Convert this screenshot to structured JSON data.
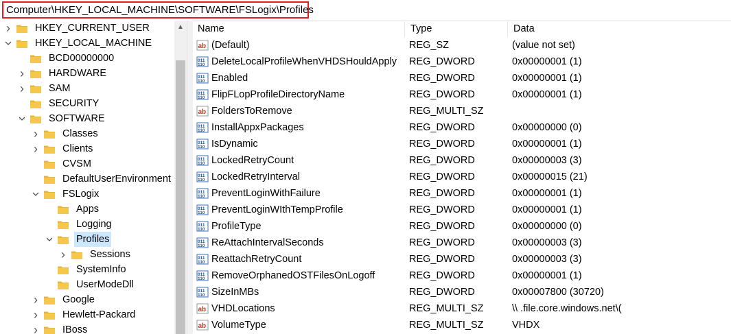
{
  "address": "Computer\\HKEY_LOCAL_MACHINE\\SOFTWARE\\FSLogix\\Profiles",
  "colors": {
    "highlight_border": "#e0201f",
    "selected_bg": "#cce8ff",
    "folder": "#e8b63c"
  },
  "tree": [
    {
      "label": "HKEY_CURRENT_USER",
      "expander": "collapsed",
      "level": 0
    },
    {
      "label": "HKEY_LOCAL_MACHINE",
      "expander": "expanded",
      "level": 0
    },
    {
      "label": "BCD00000000",
      "expander": "none",
      "level": 1
    },
    {
      "label": "HARDWARE",
      "expander": "collapsed",
      "level": 1
    },
    {
      "label": "SAM",
      "expander": "collapsed",
      "level": 1
    },
    {
      "label": "SECURITY",
      "expander": "none",
      "level": 1
    },
    {
      "label": "SOFTWARE",
      "expander": "expanded",
      "level": 1
    },
    {
      "label": "Classes",
      "expander": "collapsed",
      "level": 2
    },
    {
      "label": "Clients",
      "expander": "collapsed",
      "level": 2
    },
    {
      "label": "CVSM",
      "expander": "none",
      "level": 2
    },
    {
      "label": "DefaultUserEnvironment",
      "expander": "none",
      "level": 2
    },
    {
      "label": "FSLogix",
      "expander": "expanded",
      "level": 2
    },
    {
      "label": "Apps",
      "expander": "none",
      "level": 3
    },
    {
      "label": "Logging",
      "expander": "none",
      "level": 3
    },
    {
      "label": "Profiles",
      "expander": "expanded",
      "level": 3,
      "selected": true
    },
    {
      "label": "Sessions",
      "expander": "collapsed",
      "level": 4
    },
    {
      "label": "SystemInfo",
      "expander": "none",
      "level": 3
    },
    {
      "label": "UserModeDll",
      "expander": "none",
      "level": 3
    },
    {
      "label": "Google",
      "expander": "collapsed",
      "level": 2
    },
    {
      "label": "Hewlett-Packard",
      "expander": "collapsed",
      "level": 2
    },
    {
      "label": "IBoss",
      "expander": "collapsed",
      "level": 2
    }
  ],
  "columns": {
    "name": "Name",
    "type": "Type",
    "data": "Data"
  },
  "values": [
    {
      "icon": "string-value-icon",
      "name": "(Default)",
      "type": "REG_SZ",
      "data": "(value not set)"
    },
    {
      "icon": "binary-value-icon",
      "name": "DeleteLocalProfileWhenVHDSHouldApply",
      "type": "REG_DWORD",
      "data": "0x00000001 (1)"
    },
    {
      "icon": "binary-value-icon",
      "name": "Enabled",
      "type": "REG_DWORD",
      "data": "0x00000001 (1)"
    },
    {
      "icon": "binary-value-icon",
      "name": "FlipFLopProfileDirectoryName",
      "type": "REG_DWORD",
      "data": "0x00000001 (1)"
    },
    {
      "icon": "string-value-icon",
      "name": "FoldersToRemove",
      "type": "REG_MULTI_SZ",
      "data": ""
    },
    {
      "icon": "binary-value-icon",
      "name": "InstallAppxPackages",
      "type": "REG_DWORD",
      "data": "0x00000000 (0)"
    },
    {
      "icon": "binary-value-icon",
      "name": "IsDynamic",
      "type": "REG_DWORD",
      "data": "0x00000001 (1)"
    },
    {
      "icon": "binary-value-icon",
      "name": "LockedRetryCount",
      "type": "REG_DWORD",
      "data": "0x00000003 (3)"
    },
    {
      "icon": "binary-value-icon",
      "name": "LockedRetryInterval",
      "type": "REG_DWORD",
      "data": "0x00000015 (21)"
    },
    {
      "icon": "binary-value-icon",
      "name": "PreventLoginWithFailure",
      "type": "REG_DWORD",
      "data": "0x00000001 (1)"
    },
    {
      "icon": "binary-value-icon",
      "name": "PreventLoginWIthTempProfile",
      "type": "REG_DWORD",
      "data": "0x00000001 (1)"
    },
    {
      "icon": "binary-value-icon",
      "name": "ProfileType",
      "type": "REG_DWORD",
      "data": "0x00000000 (0)"
    },
    {
      "icon": "binary-value-icon",
      "name": "ReAttachIntervalSeconds",
      "type": "REG_DWORD",
      "data": "0x00000003 (3)"
    },
    {
      "icon": "binary-value-icon",
      "name": "ReattachRetryCount",
      "type": "REG_DWORD",
      "data": "0x00000003 (3)"
    },
    {
      "icon": "binary-value-icon",
      "name": "RemoveOrphanedOSTFilesOnLogoff",
      "type": "REG_DWORD",
      "data": "0x00000001 (1)"
    },
    {
      "icon": "binary-value-icon",
      "name": "SizeInMBs",
      "type": "REG_DWORD",
      "data": "0x00007800 (30720)"
    },
    {
      "icon": "string-value-icon",
      "name": "VHDLocations",
      "type": "REG_MULTI_SZ",
      "data": "\\\\                    .file.core.windows.net\\("
    },
    {
      "icon": "string-value-icon",
      "name": "VolumeType",
      "type": "REG_MULTI_SZ",
      "data": "VHDX"
    }
  ]
}
